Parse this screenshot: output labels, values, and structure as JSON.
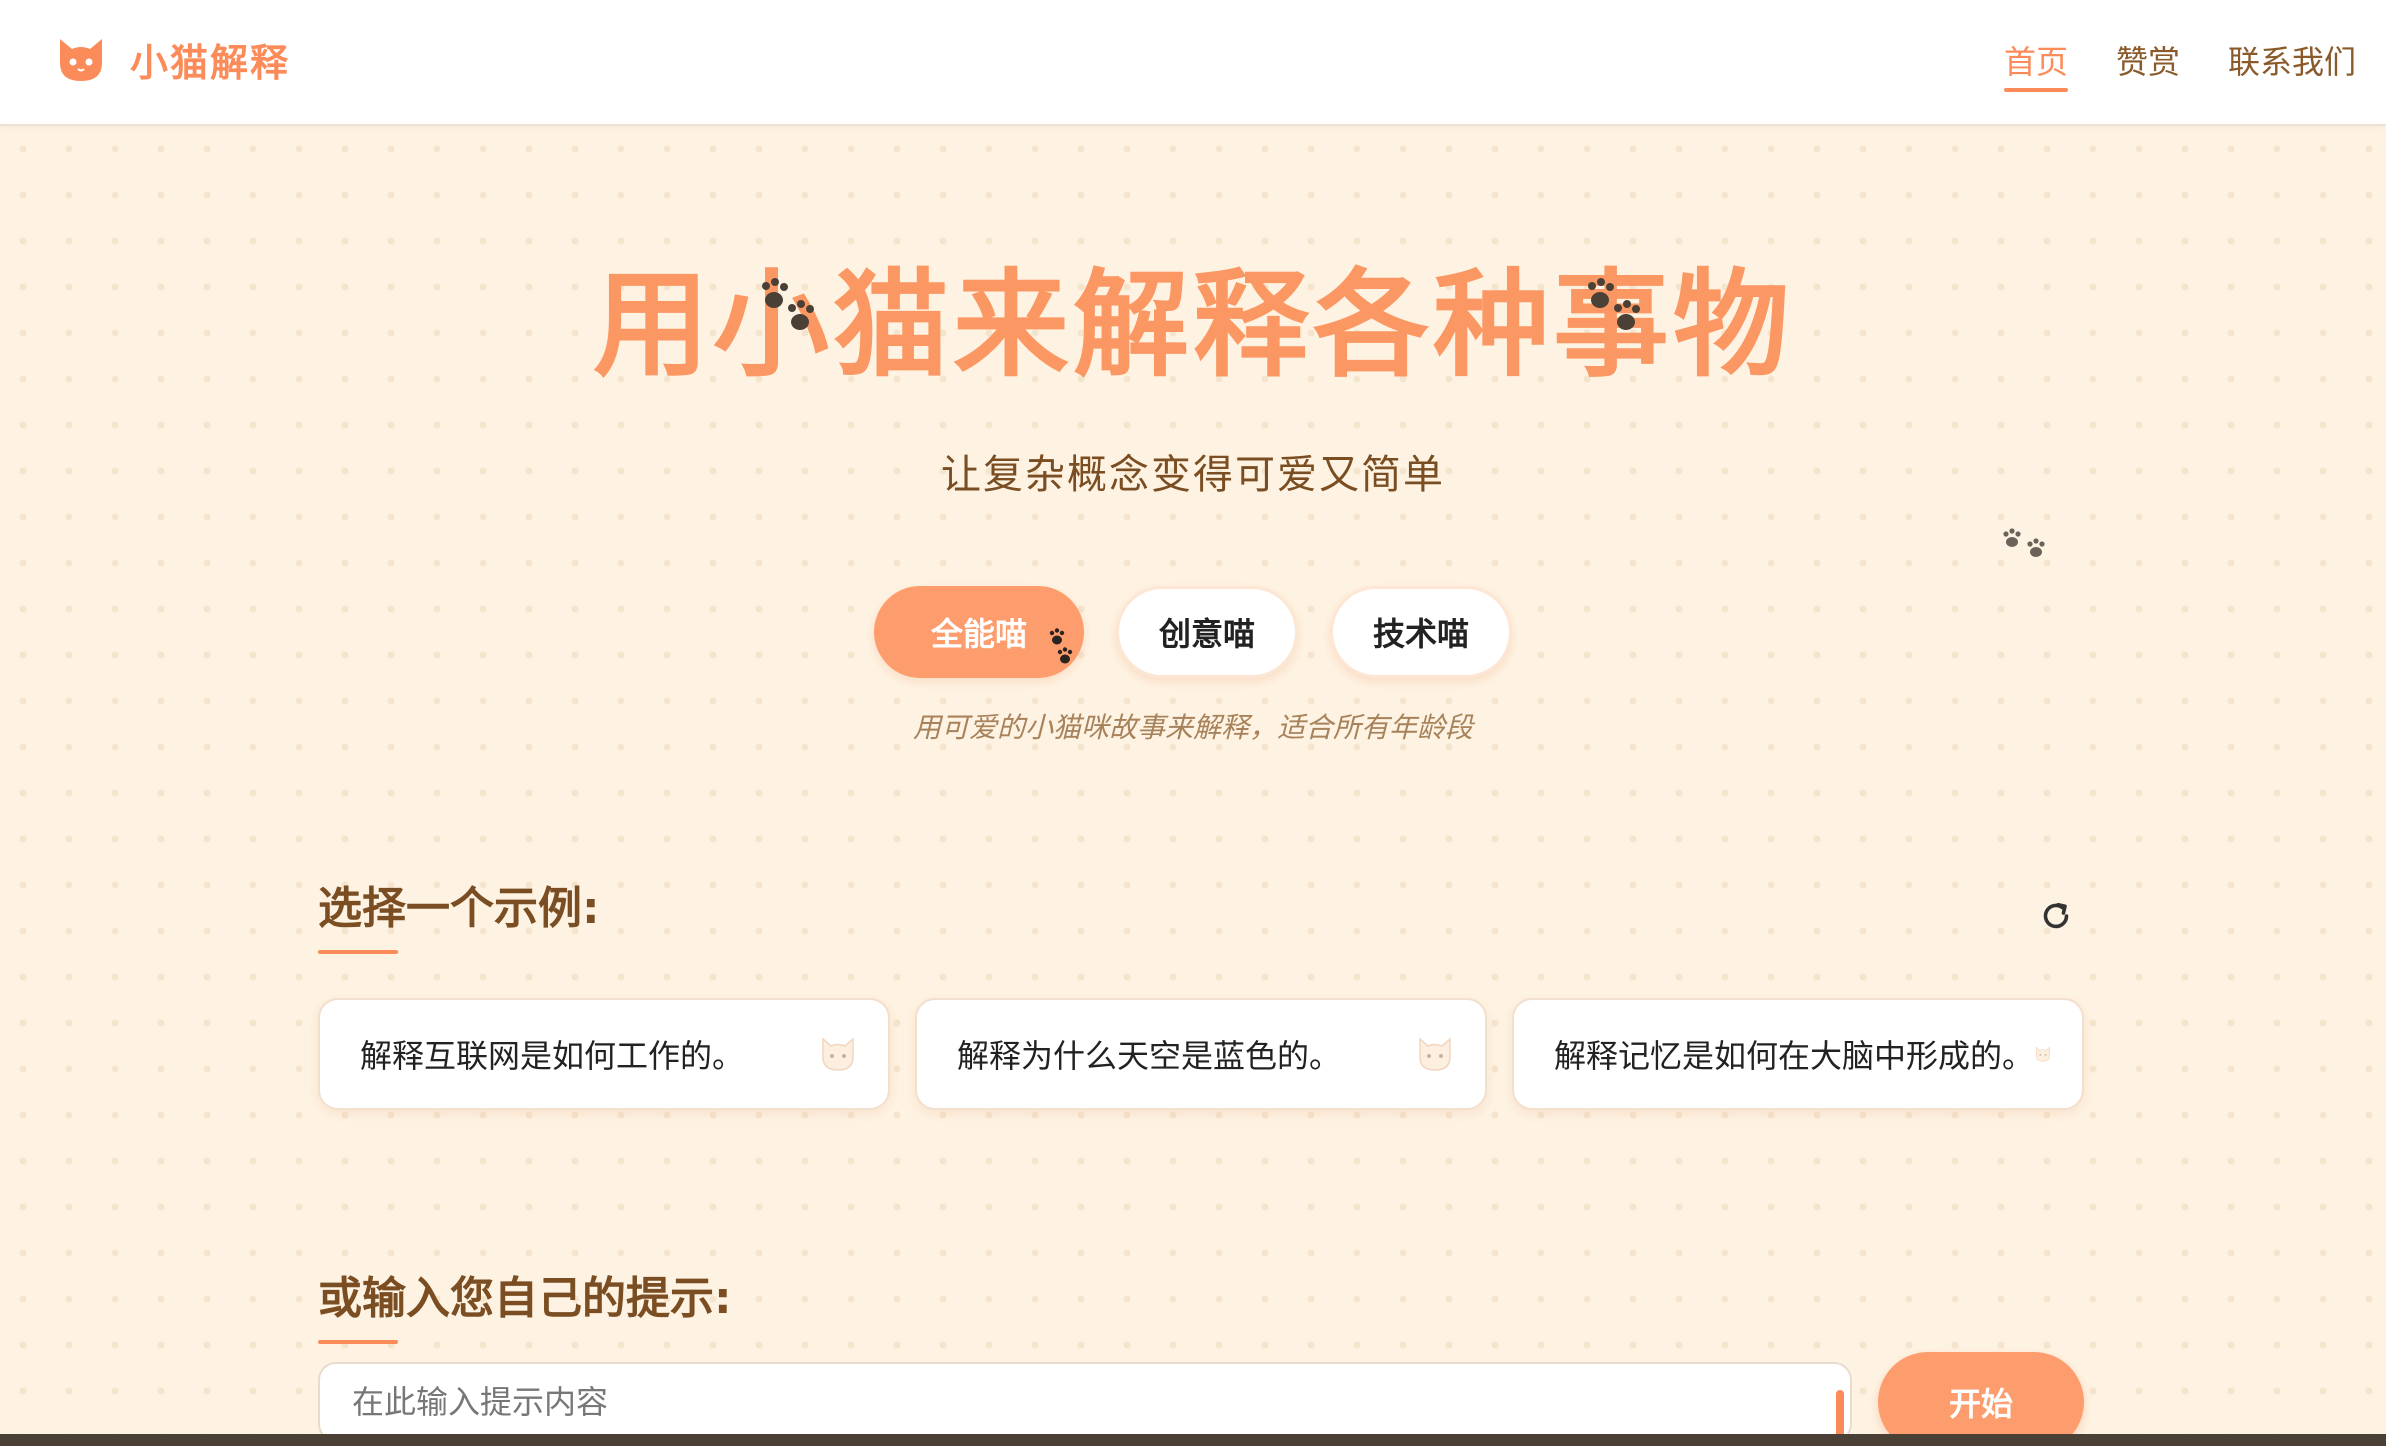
{
  "header": {
    "logo_icon": "cat-face-icon",
    "logo_text": "小猫解释",
    "nav": [
      {
        "label": "首页",
        "active": true
      },
      {
        "label": "赞赏",
        "active": false
      },
      {
        "label": "联系我们",
        "active": false
      }
    ]
  },
  "hero": {
    "title": "用小猫来解释各种事物",
    "subtitle": "让复杂概念变得可爱又简单"
  },
  "modes": {
    "buttons": [
      {
        "label": "全能喵",
        "active": true
      },
      {
        "label": "创意喵",
        "active": false
      },
      {
        "label": "技术喵",
        "active": false
      }
    ],
    "description": "用可爱的小猫咪故事来解释，适合所有年龄段"
  },
  "examples": {
    "title": "选择一个示例:",
    "refresh_icon": "refresh-icon",
    "items": [
      {
        "text": "解释互联网是如何工作的。",
        "icon": "cat-face-icon"
      },
      {
        "text": "解释为什么天空是蓝色的。",
        "icon": "cat-face-icon"
      },
      {
        "text": "解释记忆是如何在大脑中形成的。",
        "icon": "cat-face-icon"
      }
    ]
  },
  "prompt": {
    "title": "或输入您自己的提示:",
    "placeholder": "在此输入提示内容",
    "value": "",
    "start_label": "开始"
  },
  "colors": {
    "accent": "#fb8c5a",
    "button_active": "#fd9d6e",
    "background": "#fef3e3",
    "heading_brown": "#7a4e22"
  }
}
